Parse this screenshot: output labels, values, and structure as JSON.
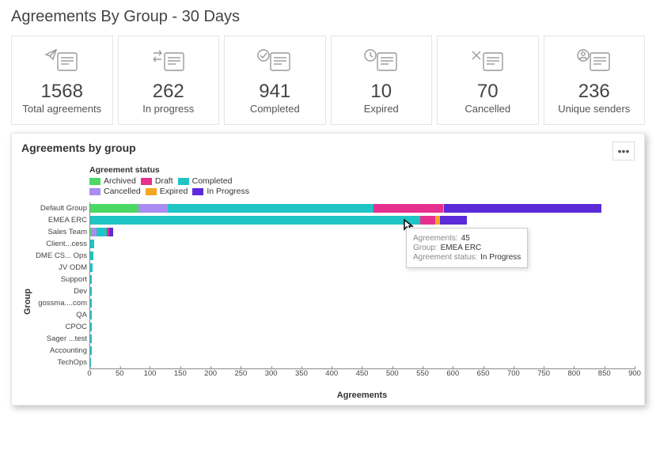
{
  "title": "Agreements By Group - 30 Days",
  "cards": [
    {
      "id": "total",
      "value": "1568",
      "label": "Total agreements"
    },
    {
      "id": "progress",
      "value": "262",
      "label": "In progress"
    },
    {
      "id": "completed",
      "value": "941",
      "label": "Completed"
    },
    {
      "id": "expired",
      "value": "10",
      "label": "Expired"
    },
    {
      "id": "cancelled",
      "value": "70",
      "label": "Cancelled"
    },
    {
      "id": "unique",
      "value": "236",
      "label": "Unique senders"
    }
  ],
  "panel": {
    "title": "Agreements by group"
  },
  "legend": {
    "title": "Agreement status",
    "rows": [
      [
        {
          "name": "Archived",
          "color": "#4bd964"
        },
        {
          "name": "Draft",
          "color": "#e6308f"
        },
        {
          "name": "Completed",
          "color": "#1fc4c4"
        }
      ],
      [
        {
          "name": "Cancelled",
          "color": "#a98df0"
        },
        {
          "name": "Expired",
          "color": "#f5a623"
        },
        {
          "name": "In Progress",
          "color": "#5b2bd9"
        }
      ]
    ]
  },
  "tooltip": {
    "rows": [
      {
        "k": "Agreements:",
        "v": "45"
      },
      {
        "k": "Group:",
        "v": "EMEA ERC"
      },
      {
        "k": "Agreement status:",
        "v": "In Progress"
      }
    ]
  },
  "chart_data": {
    "type": "bar",
    "orientation": "horizontal",
    "stacked": true,
    "title": "Agreements by group",
    "ylabel": "Group",
    "xlabel": "Agreements",
    "xlim": [
      0,
      900
    ],
    "xticks": [
      0,
      50,
      100,
      150,
      200,
      250,
      300,
      350,
      400,
      450,
      500,
      550,
      600,
      650,
      700,
      750,
      800,
      850,
      900
    ],
    "legend_position": "top",
    "statuses": [
      "Archived",
      "Cancelled",
      "Completed",
      "Draft",
      "Expired",
      "In Progress"
    ],
    "colors": {
      "Archived": "#4bd964",
      "Cancelled": "#a98df0",
      "Completed": "#1fc4c4",
      "Draft": "#e6308f",
      "Expired": "#f5a623",
      "In Progress": "#5b2bd9"
    },
    "categories": [
      "Default Group",
      "EMEA ERC",
      "Sales Team",
      "Client...cess",
      "DME CS... Ops",
      "JV ODM",
      "Support",
      "Dev",
      "gossma....com",
      "QA",
      "CPOC",
      "Sager ...test",
      "Accounting",
      "TechOps"
    ],
    "series": [
      {
        "name": "Archived",
        "values": [
          80,
          0,
          2,
          0,
          0,
          0,
          0,
          0,
          0,
          0,
          0,
          0,
          0,
          0
        ]
      },
      {
        "name": "Cancelled",
        "values": [
          48,
          0,
          8,
          0,
          0,
          0,
          0,
          0,
          0,
          0,
          0,
          0,
          0,
          0
        ]
      },
      {
        "name": "Completed",
        "values": [
          340,
          545,
          18,
          6,
          5,
          4,
          3,
          3,
          3,
          2,
          2,
          2,
          2,
          1
        ]
      },
      {
        "name": "Draft",
        "values": [
          115,
          25,
          4,
          0,
          0,
          0,
          0,
          0,
          0,
          0,
          0,
          0,
          0,
          0
        ]
      },
      {
        "name": "Expired",
        "values": [
          2,
          8,
          0,
          0,
          0,
          0,
          0,
          0,
          0,
          0,
          0,
          0,
          0,
          0
        ]
      },
      {
        "name": "In Progress",
        "values": [
          260,
          45,
          6,
          0,
          0,
          0,
          0,
          0,
          0,
          0,
          0,
          0,
          0,
          0
        ]
      }
    ]
  }
}
